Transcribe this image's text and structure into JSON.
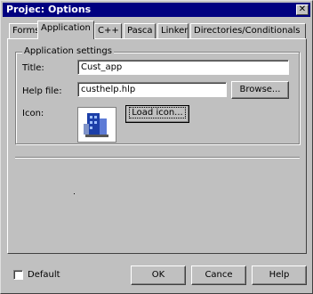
{
  "window": {
    "title": "Projec: Options",
    "close_glyph": "✕"
  },
  "tabs": [
    {
      "label": "Forms"
    },
    {
      "label": "Application"
    },
    {
      "label": "C++"
    },
    {
      "label": "Pasca"
    },
    {
      "label": "Linker"
    },
    {
      "label": "Directories/Conditionals"
    }
  ],
  "active_tab": 1,
  "group": {
    "label": "Application settings"
  },
  "fields": {
    "title": {
      "label": "Title:",
      "value": "Cust_app"
    },
    "help_file": {
      "label": "Help file:",
      "value": "custhelp.hlp",
      "browse_label": "Browse..."
    },
    "icon": {
      "label": "Icon:",
      "load_label": "Load icon..."
    }
  },
  "footer": {
    "default_label": "Default",
    "ok_label": "OK",
    "cancel_label": "Cance",
    "help_label": "Help"
  }
}
